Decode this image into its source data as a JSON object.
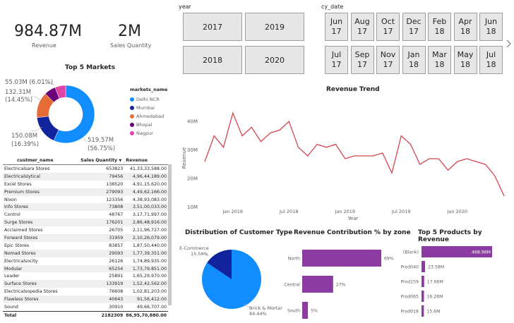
{
  "kpis": {
    "revenue_value": "984.87M",
    "revenue_label": "Revenue",
    "qty_value": "2M",
    "qty_label": "Sales Quantity"
  },
  "slicers": {
    "year_label": "year",
    "years": [
      "2017",
      "2019",
      "2018",
      "2020"
    ],
    "cy_label": "cy_date",
    "months": [
      [
        "Jun",
        "17"
      ],
      [
        "Aug",
        "17"
      ],
      [
        "Oct",
        "17"
      ],
      [
        "Dec",
        "17"
      ],
      [
        "Feb",
        "18"
      ],
      [
        "Apr",
        "18"
      ],
      [
        "Jun",
        "18"
      ],
      [
        "Jul",
        "17"
      ],
      [
        "Sep",
        "17"
      ],
      [
        "Nov",
        "17"
      ],
      [
        "Jan",
        "18"
      ],
      [
        "Mar",
        "18"
      ],
      [
        "May",
        "18"
      ],
      [
        "Jul",
        "18"
      ]
    ]
  },
  "top_markets": {
    "title": "Top 5 Markets",
    "legend_title": "markets_name",
    "labels": {
      "l1": "55.03M (6.01%)",
      "l2a": "132.31M",
      "l2b": "(14.45%)",
      "l3a": "150.08M",
      "l3b": "(16.39%)",
      "l4a": "519.57M",
      "l4b": "(56.75%)"
    }
  },
  "table": {
    "headers": [
      "custmer_name",
      "Sales Quantity",
      "Revenue"
    ],
    "rows": [
      [
        "Electricalsara Stores",
        "653823",
        "41,33,33,588.00"
      ],
      [
        "Electricalslytical",
        "79456",
        "4,96,44,189.00"
      ],
      [
        "Excel Stores",
        "138520",
        "4,91,15,620.00"
      ],
      [
        "Premium Stores",
        "279093",
        "4,49,62,166.00"
      ],
      [
        "Nixon",
        "123356",
        "4,38,93,083.00"
      ],
      [
        "Info Stores",
        "73808",
        "3,51,00,033.00"
      ],
      [
        "Control",
        "48767",
        "3,17,71,997.00"
      ],
      [
        "Surge Stores",
        "176201",
        "2,86,48,916.00"
      ],
      [
        "Acclaimed Stores",
        "26705",
        "2,11,96,727.00"
      ],
      [
        "Forward Stores",
        "31959",
        "2,10,26,079.00"
      ],
      [
        "Epic Stores",
        "83857",
        "1,87,50,440.00"
      ],
      [
        "Nomad Stores",
        "29093",
        "1,77,39,351.00"
      ],
      [
        "Electricalsocity",
        "26126",
        "1,74,89,935.00"
      ],
      [
        "Modular",
        "65254",
        "1,73,79,851.00"
      ],
      [
        "Leader",
        "25891",
        "1,65,29,970.00"
      ],
      [
        "Surface Stores",
        "133919",
        "1,52,42,562.00"
      ],
      [
        "Electricalsopedia Stores",
        "76608",
        "1,02,81,203.00"
      ],
      [
        "Flawless Stores",
        "40643",
        "91,56,412.00"
      ],
      [
        "Sound",
        "30910",
        "49,66,707.00"
      ]
    ],
    "total": [
      "Total",
      "2182309",
      "86,95,70,880.00"
    ]
  },
  "revenue_trend": {
    "title": "Revenue Trend",
    "ylabel": "Revenue",
    "xlabel": "Year",
    "yticks": [
      "40M",
      "30M",
      "20M",
      "10M"
    ],
    "xticks": [
      "Jan 2018",
      "Jul 2018",
      "Jan 2019",
      "Jul 2019",
      "Jan 2020"
    ]
  },
  "customer_type": {
    "title": "Distribution of Customer Type"
  },
  "zone": {
    "title": "Revenue Contribution % by zone"
  },
  "top_products": {
    "title": "Top 5 Products by Revenue"
  },
  "colors": {
    "market_series": [
      "#118DFF",
      "#12239E",
      "#E66C37",
      "#6B007B",
      "#E044A7"
    ],
    "trend_line": "#D64550",
    "bar_purple": "#8B3BA1"
  },
  "chart_data": [
    {
      "type": "pie",
      "subtype": "donut",
      "title": "Top 5 Markets",
      "legend_title": "markets_name",
      "legend_position": "right",
      "slices": [
        {
          "name": "Delhi NCR",
          "value": 519.57,
          "percent": 56.75,
          "label": "519.57M (56.75%)"
        },
        {
          "name": "Mumbai",
          "value": 150.08,
          "percent": 16.39,
          "label": "150.08M (16.39%)"
        },
        {
          "name": "Ahmedabad",
          "value": 132.31,
          "percent": 14.45,
          "label": "132.31M (14.45%)"
        },
        {
          "name": "Bhopal",
          "value": 58.45,
          "percent": 6.39
        },
        {
          "name": "Nagpur",
          "value": 55.03,
          "percent": 6.01,
          "label": "55.03M (6.01%)"
        }
      ]
    },
    {
      "type": "line",
      "title": "Revenue Trend",
      "xlabel": "Year",
      "ylabel": "Revenue",
      "xlim": [
        "2017-10",
        "2020-06"
      ],
      "ylim": [
        10,
        45
      ],
      "yunit": "M",
      "yticks": [
        10,
        20,
        30,
        40
      ],
      "xticks": [
        "Jan 2018",
        "Jul 2018",
        "Jan 2019",
        "Jul 2019",
        "Jan 2020"
      ],
      "x": [
        "2017-10",
        "2017-11",
        "2017-12",
        "2018-01",
        "2018-02",
        "2018-03",
        "2018-04",
        "2018-05",
        "2018-06",
        "2018-07",
        "2018-08",
        "2018-09",
        "2018-10",
        "2018-11",
        "2018-12",
        "2019-01",
        "2019-02",
        "2019-03",
        "2019-04",
        "2019-05",
        "2019-06",
        "2019-07",
        "2019-08",
        "2019-09",
        "2019-10",
        "2019-11",
        "2019-12",
        "2020-01",
        "2020-02",
        "2020-03",
        "2020-04",
        "2020-05",
        "2020-06"
      ],
      "values": [
        26,
        35,
        31,
        43,
        35,
        38,
        33,
        36,
        37,
        40,
        31,
        28,
        32,
        31,
        32,
        27,
        28,
        28,
        28,
        29,
        22,
        35,
        32,
        25,
        27,
        27,
        23,
        26,
        27,
        26,
        25,
        21,
        14
      ]
    },
    {
      "type": "pie",
      "title": "Distribution of Customer Type",
      "slices": [
        {
          "name": "E-Commerce",
          "percent": 15.56
        },
        {
          "name": "Brick & Mortar",
          "percent": 84.44
        }
      ]
    },
    {
      "type": "bar",
      "orientation": "horizontal",
      "title": "Revenue Contribution % by zone",
      "categories": [
        "North",
        "Central",
        "South"
      ],
      "values": [
        69,
        27,
        5
      ],
      "labels": [
        "69%",
        "27%",
        "5%"
      ]
    },
    {
      "type": "bar",
      "orientation": "horizontal",
      "title": "Top 5 Products by Revenue",
      "categories": [
        "(Blank)",
        "Prod040",
        "Prod159",
        "Prod065",
        "Prod018"
      ],
      "values": [
        468.96,
        23.58,
        17.66,
        16.26,
        15.6
      ],
      "labels": [
        "468.96M",
        "23.58M",
        "17.66M",
        "16.26M",
        "15.6M"
      ]
    }
  ]
}
